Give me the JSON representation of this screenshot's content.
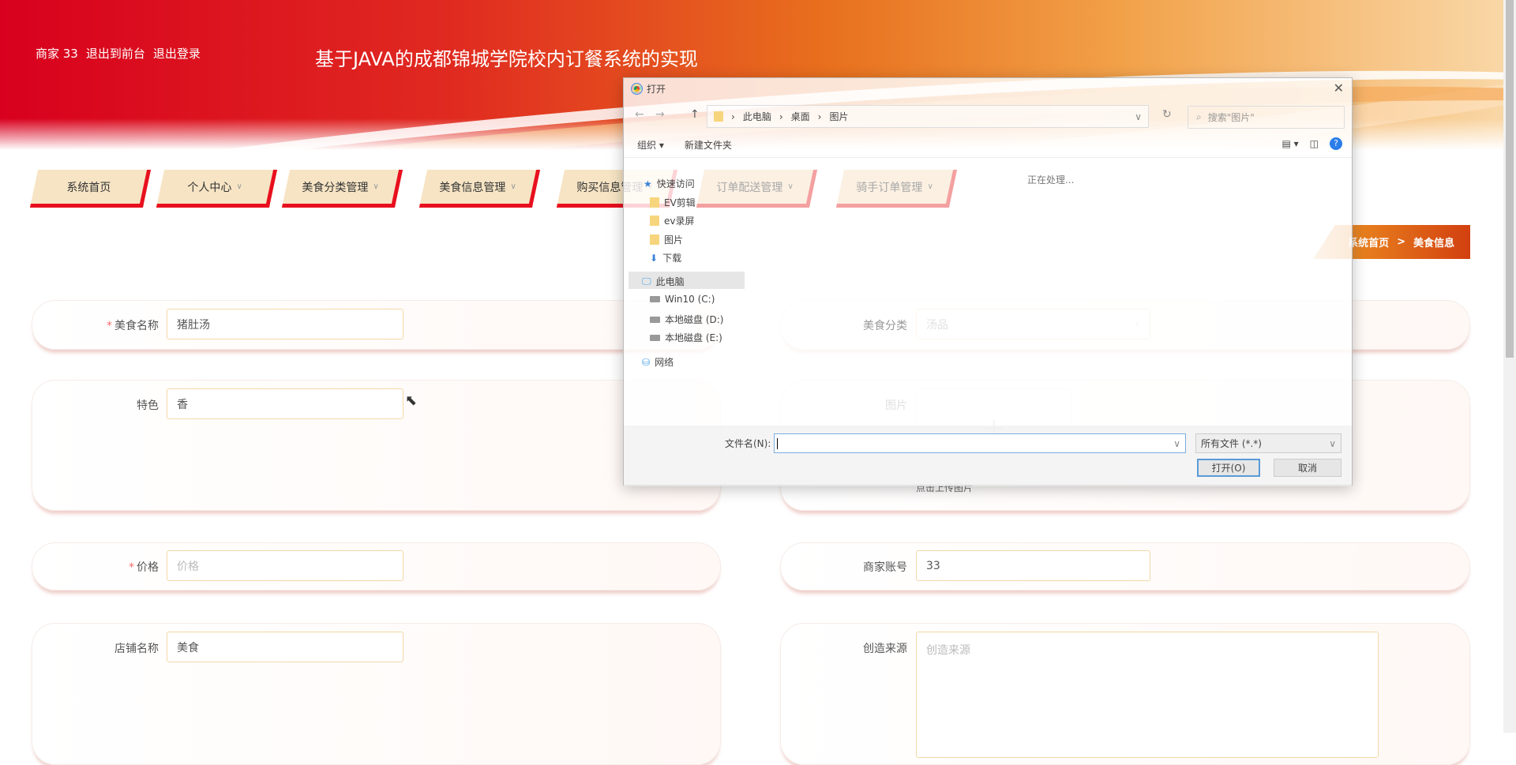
{
  "header": {
    "user": "商家 33",
    "to_front": "退出到前台",
    "logout": "退出登录",
    "title": "基于JAVA的成都锦城学院校内订餐系统的实现"
  },
  "nav": [
    {
      "label": "系统首页",
      "dropdown": false
    },
    {
      "label": "个人中心",
      "dropdown": true
    },
    {
      "label": "美食分类管理",
      "dropdown": true
    },
    {
      "label": "美食信息管理",
      "dropdown": true
    },
    {
      "label": "购买信息管理",
      "dropdown": true
    },
    {
      "label": "订单配送管理",
      "dropdown": true
    },
    {
      "label": "骑手订单管理",
      "dropdown": true
    }
  ],
  "breadcrumb": {
    "home": "系统首页",
    "sep": ">",
    "current": "美食信息"
  },
  "form": {
    "name": {
      "label": "美食名称",
      "value": "猪肚汤",
      "required": true
    },
    "category": {
      "label": "美食分类",
      "value": "汤品"
    },
    "feature": {
      "label": "特色",
      "value": "香"
    },
    "image": {
      "label": "图片",
      "hint": "点击上传图片"
    },
    "price": {
      "label": "价格",
      "placeholder": "价格",
      "required": true
    },
    "merchant": {
      "label": "商家账号",
      "value": "33"
    },
    "shop": {
      "label": "店铺名称",
      "value": "美食"
    },
    "origin": {
      "label": "创造来源",
      "placeholder": "创造来源"
    },
    "required_mark": "*"
  },
  "dialog": {
    "title": "打开",
    "path": [
      "此电脑",
      "桌面",
      "图片"
    ],
    "search_placeholder": "搜索\"图片\"",
    "organize": "组织 ▾",
    "new_folder": "新建文件夹",
    "status": "正在处理...",
    "tree": [
      {
        "label": "快速访问",
        "icon": "star"
      },
      {
        "label": "EV剪辑",
        "icon": "folder"
      },
      {
        "label": "ev录屏",
        "icon": "folder"
      },
      {
        "label": "图片",
        "icon": "folder"
      },
      {
        "label": "下载",
        "icon": "download"
      },
      {
        "label": "此电脑",
        "icon": "computer"
      },
      {
        "label": "Win10 (C:)",
        "icon": "drive"
      },
      {
        "label": "本地磁盘 (D:)",
        "icon": "drive"
      },
      {
        "label": "本地磁盘 (E:)",
        "icon": "drive"
      },
      {
        "label": "网络",
        "icon": "network"
      }
    ],
    "filename_label": "文件名(N):",
    "filename_value": "",
    "filter": "所有文件 (*.*)",
    "open": "打开(O)",
    "cancel": "取消"
  }
}
